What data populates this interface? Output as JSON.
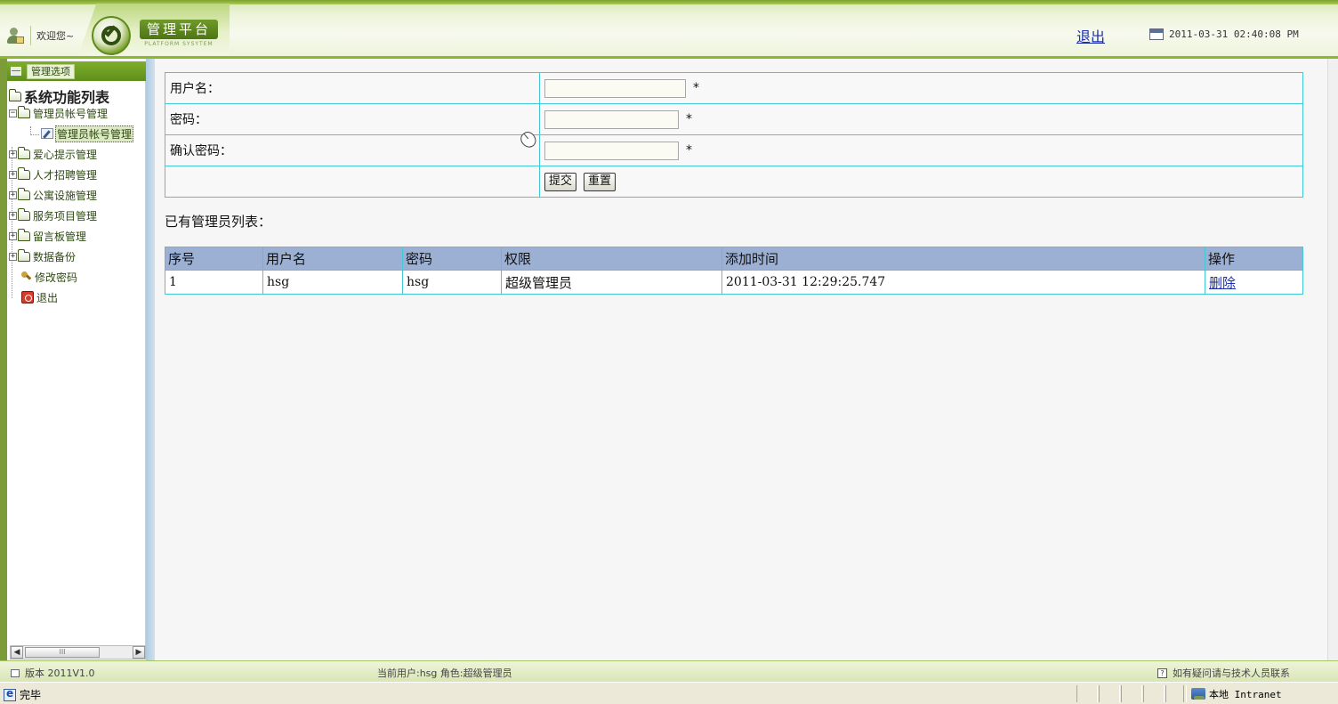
{
  "header": {
    "welcome": "欢迎您~",
    "platform_title": "管理平台",
    "platform_subtitle": "PLATFORM SYSYTEM",
    "logout": "退出",
    "datetime": "2011-03-31 02:40:08 PM"
  },
  "sidebar": {
    "panel_label": "管理选项",
    "root_label": "系统功能列表",
    "items": [
      {
        "label": "管理员帐号管理",
        "toggle": "−"
      },
      {
        "label": "爱心提示管理",
        "toggle": "+"
      },
      {
        "label": "人才招聘管理",
        "toggle": "+"
      },
      {
        "label": "公寓设施管理",
        "toggle": "+"
      },
      {
        "label": "服务项目管理",
        "toggle": "+"
      },
      {
        "label": "留言板管理",
        "toggle": "+"
      },
      {
        "label": "数据备份",
        "toggle": "+"
      }
    ],
    "child_label": "管理员帐号管理",
    "change_password": "修改密码",
    "logout": "退出",
    "scroll_grip": "III"
  },
  "form": {
    "username_label": "用户名：",
    "password_label": "密码：",
    "confirm_label": "确认密码：",
    "required_mark": "*",
    "submit": "提交",
    "reset": "重置"
  },
  "list": {
    "caption": "已有管理员列表：",
    "headers": [
      "序号",
      "用户名",
      "密码",
      "权限",
      "添加时间",
      "操作"
    ],
    "rows": [
      {
        "no": "1",
        "username": "hsg",
        "password": "hsg",
        "role": "超级管理员",
        "added": "2011-03-31 12:29:25.747",
        "action": "删除"
      }
    ]
  },
  "footer": {
    "version": "版本 2011V1.0",
    "current_user": "当前用户:hsg  角色:超级管理员",
    "help": "如有疑问请与技术人员联系"
  },
  "statusbar": {
    "status": "完毕",
    "zone": "本地 Intranet"
  }
}
